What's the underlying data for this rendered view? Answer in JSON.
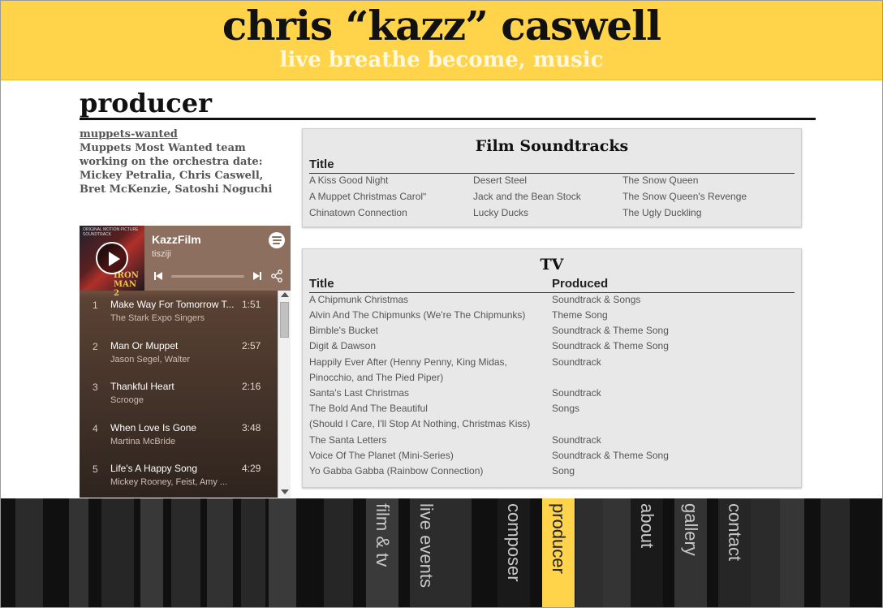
{
  "site": {
    "title": "chris “kazz” caswell",
    "tagline": "live breathe become, music"
  },
  "page": {
    "heading": "producer"
  },
  "caption": {
    "link": "muppets-wanted",
    "text": "Muppets Most Wanted team working on the orchestra date: Mickey Petralia, Chris Caswell, Bret McKenzie, Satoshi Noguchi"
  },
  "player": {
    "title": "KazzFilm",
    "user": "tisziji",
    "album_text": "ORIGINAL MOTION PICTURE SOUNDTRACK",
    "album_logo": "IRON MAN 2",
    "tracks": [
      {
        "num": "1",
        "title": "Make Way For Tomorrow T...",
        "artist": "The Stark Expo Singers",
        "duration": "1:51"
      },
      {
        "num": "2",
        "title": "Man Or Muppet",
        "artist": "Jason Segel, Walter",
        "duration": "2:57"
      },
      {
        "num": "3",
        "title": "Thankful Heart",
        "artist": "Scrooge",
        "duration": "2:16"
      },
      {
        "num": "4",
        "title": "When Love Is Gone",
        "artist": "Martina McBride",
        "duration": "3:48"
      },
      {
        "num": "5",
        "title": "Life's A Happy Song",
        "artist": "Mickey Rooney, Feist, Amy ...",
        "duration": "4:29"
      }
    ]
  },
  "film": {
    "title": "Film Soundtracks",
    "col_title": "Title",
    "columns": [
      [
        "A Kiss Good Night",
        "A Muppet Christmas Carolʺ",
        "Chinatown Connection"
      ],
      [
        "Desert Steel",
        "Jack and the Bean Stock",
        "Lucky Ducks"
      ],
      [
        "The Snow Queen",
        "The Snow Queen's Revenge",
        "The Ugly Duckling"
      ]
    ]
  },
  "tv": {
    "title": "TV",
    "col_title": "Title",
    "col_produced": "Produced",
    "rows": [
      {
        "title": "A Chipmunk Christmas",
        "produced": "Soundtrack & Songs"
      },
      {
        "title": "Alvin And The Chipmunks (We're The Chipmunks)",
        "produced": "Theme Song"
      },
      {
        "title": "Bimble's Bucket",
        "produced": "Soundtrack & Theme Song"
      },
      {
        "title": "Digit & Dawson",
        "produced": "Soundtrack & Theme Song"
      },
      {
        "title": "Happily Ever After (Henny Penny, King Midas,",
        "produced": "Soundtrack"
      },
      {
        "title": "Pinocchio, and The Pied Piper)",
        "produced": ""
      },
      {
        "title": "Santa's Last Christmas",
        "produced": "Soundtrack"
      },
      {
        "title": "The Bold And The Beautiful",
        "produced": "Songs"
      },
      {
        "title": "(Should I Care, I'll Stop At Nothing, Christmas Kiss)",
        "produced": ""
      },
      {
        "title": "The Santa Letters",
        "produced": "Soundtrack"
      },
      {
        "title": "Voice Of The Planet (Mini-Series)",
        "produced": "Soundtrack & Theme Song"
      },
      {
        "title": "Yo Gabba Gabba (Rainbow Connection)",
        "produced": "Song"
      }
    ]
  },
  "nav": {
    "items": [
      {
        "label": "film & tv",
        "active": false
      },
      {
        "label": "live events",
        "active": false
      },
      {
        "label": "composer",
        "active": false
      },
      {
        "label": "producer",
        "active": true
      },
      {
        "label": "about",
        "active": false
      },
      {
        "label": "gallery",
        "active": false
      },
      {
        "label": "contact",
        "active": false
      }
    ]
  },
  "colors": {
    "accent": "#ffd34a",
    "nav_bg": "#101010",
    "panel_bg": "#e8e8e8"
  }
}
